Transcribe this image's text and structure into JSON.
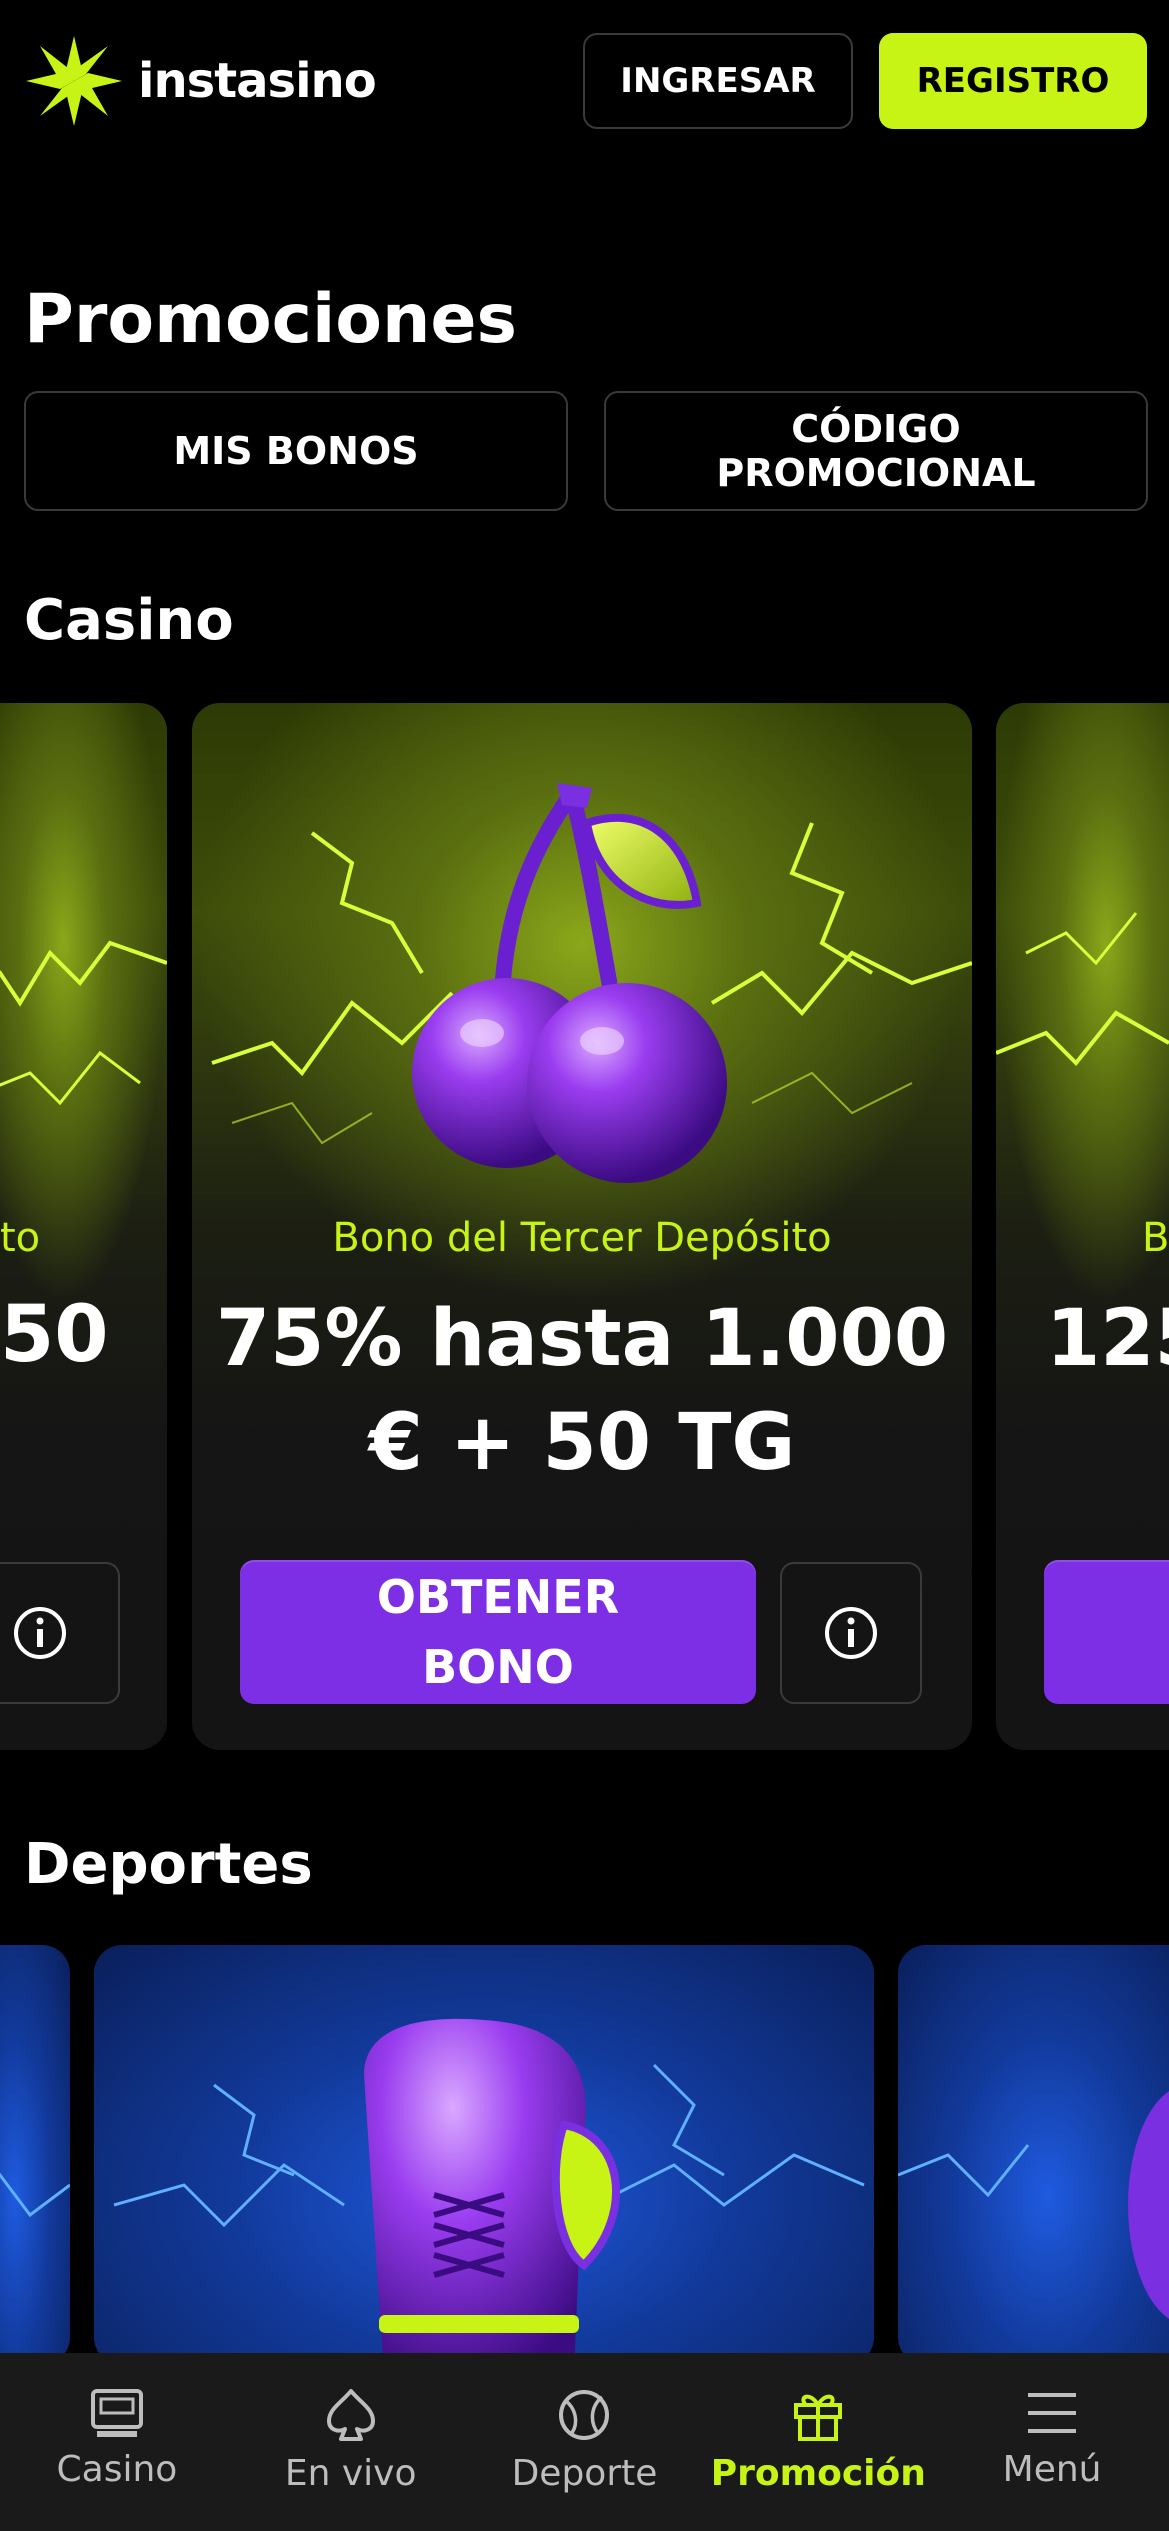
{
  "header": {
    "brand": "instasino",
    "login_label": "INGRESAR",
    "register_label": "REGISTRO"
  },
  "page": {
    "title": "Promociones",
    "tabs": [
      {
        "label": "MIS BONOS"
      },
      {
        "label_line1": "CÓDIGO",
        "label_line2": "PROMOCIONAL"
      }
    ]
  },
  "casino": {
    "section_title": "Casino",
    "left_card": {
      "subtitle_fragment": "to",
      "amount_fragment": "50"
    },
    "main_card": {
      "subtitle": "Bono del Tercer Depósito",
      "amount_line1": "75% hasta 1.000",
      "amount_line2": "€ + 50 TG",
      "cta_line1": "OBTENER",
      "cta_line2": "BONO"
    },
    "right_card": {
      "subtitle_fragment": "B",
      "amount_fragment": "125"
    }
  },
  "sports": {
    "section_title": "Deportes"
  },
  "nav": {
    "items": [
      {
        "label": "Casino",
        "icon": "slot-machine-icon",
        "active": false
      },
      {
        "label": "En vivo",
        "icon": "spade-icon",
        "active": false
      },
      {
        "label": "Deporte",
        "icon": "ball-icon",
        "active": false
      },
      {
        "label": "Promoción",
        "icon": "gift-icon",
        "active": true
      },
      {
        "label": "Menú",
        "icon": "menu-icon",
        "active": false
      }
    ]
  },
  "colors": {
    "accent": "#c8f415",
    "cta_purple": "#7d2fe6",
    "background": "#000000",
    "nav_background": "#1a1a1a"
  }
}
